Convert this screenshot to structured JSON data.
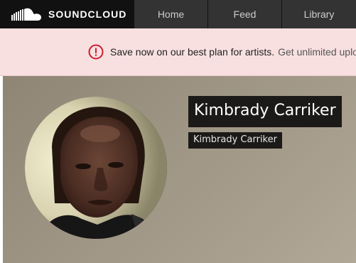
{
  "nav": {
    "logo_text": "SOUNDCLOUD",
    "logo_icon": "soundcloud-cloud-icon",
    "items": [
      {
        "label": "Home"
      },
      {
        "label": "Feed"
      },
      {
        "label": "Library"
      }
    ]
  },
  "banner": {
    "icon": "alert-circle-icon",
    "lead": "Save now on our best plan for artists.",
    "rest": "Get unlimited uploads and more."
  },
  "profile": {
    "display_name": "Kimbrady Carriker",
    "username": "Kimbrady Carriker",
    "avatar_icon": "profile-photo"
  },
  "colors": {
    "nav_bg": "#333333",
    "logo_bg": "#111111",
    "banner_bg": "#f8e0e1",
    "alert_red": "#cc1f2d",
    "name_bg": "#1c1a18"
  }
}
